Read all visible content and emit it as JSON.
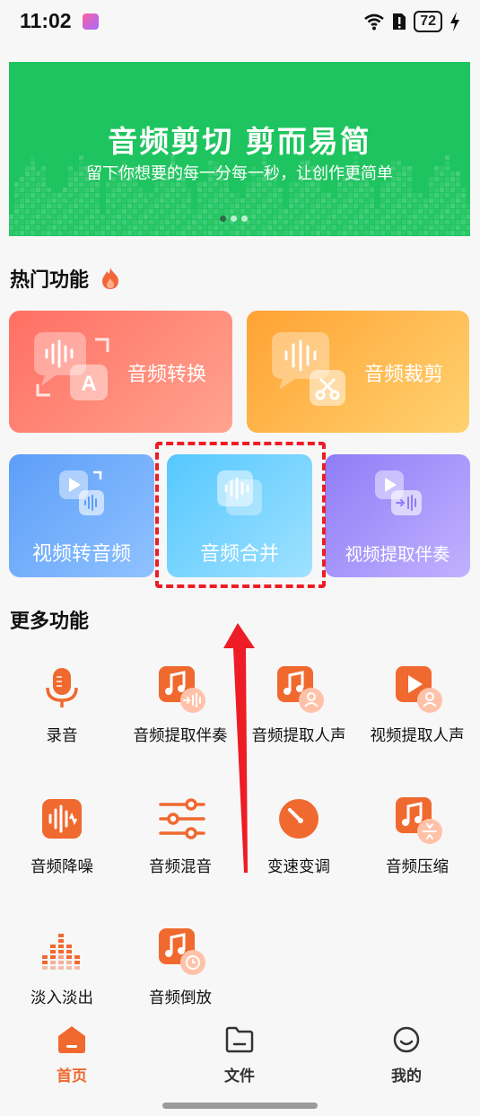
{
  "status": {
    "time": "11:02",
    "battery": "72"
  },
  "banner": {
    "title": "音频剪切 剪而易简",
    "subtitle": "留下你想要的每一分每一秒，让创作更简单"
  },
  "hot": {
    "title": "热门功能",
    "cards": [
      {
        "label": "音频转换"
      },
      {
        "label": "音频裁剪"
      },
      {
        "label": "视频转音频"
      },
      {
        "label": "音频合并"
      },
      {
        "label": "视频提取伴奏"
      }
    ]
  },
  "more": {
    "title": "更多功能",
    "items": [
      {
        "label": "录音",
        "icon": "microphone-icon"
      },
      {
        "label": "音频提取伴奏",
        "icon": "music-note-extract-icon"
      },
      {
        "label": "音频提取人声",
        "icon": "music-note-person-icon"
      },
      {
        "label": "视频提取人声",
        "icon": "video-person-icon"
      },
      {
        "label": "音频降噪",
        "icon": "waveform-icon"
      },
      {
        "label": "音频混音",
        "icon": "sliders-icon"
      },
      {
        "label": "变速变调",
        "icon": "speedometer-icon"
      },
      {
        "label": "音频压缩",
        "icon": "compress-icon"
      },
      {
        "label": "淡入淡出",
        "icon": "fade-bars-icon"
      },
      {
        "label": "音频倒放",
        "icon": "reverse-clock-icon"
      }
    ]
  },
  "tabbar": {
    "tabs": [
      {
        "label": "首页"
      },
      {
        "label": "文件"
      },
      {
        "label": "我的"
      }
    ]
  },
  "colors": {
    "accent": "#f0692f",
    "banner": "#1ec45f",
    "highlight": "#ee1c24"
  }
}
